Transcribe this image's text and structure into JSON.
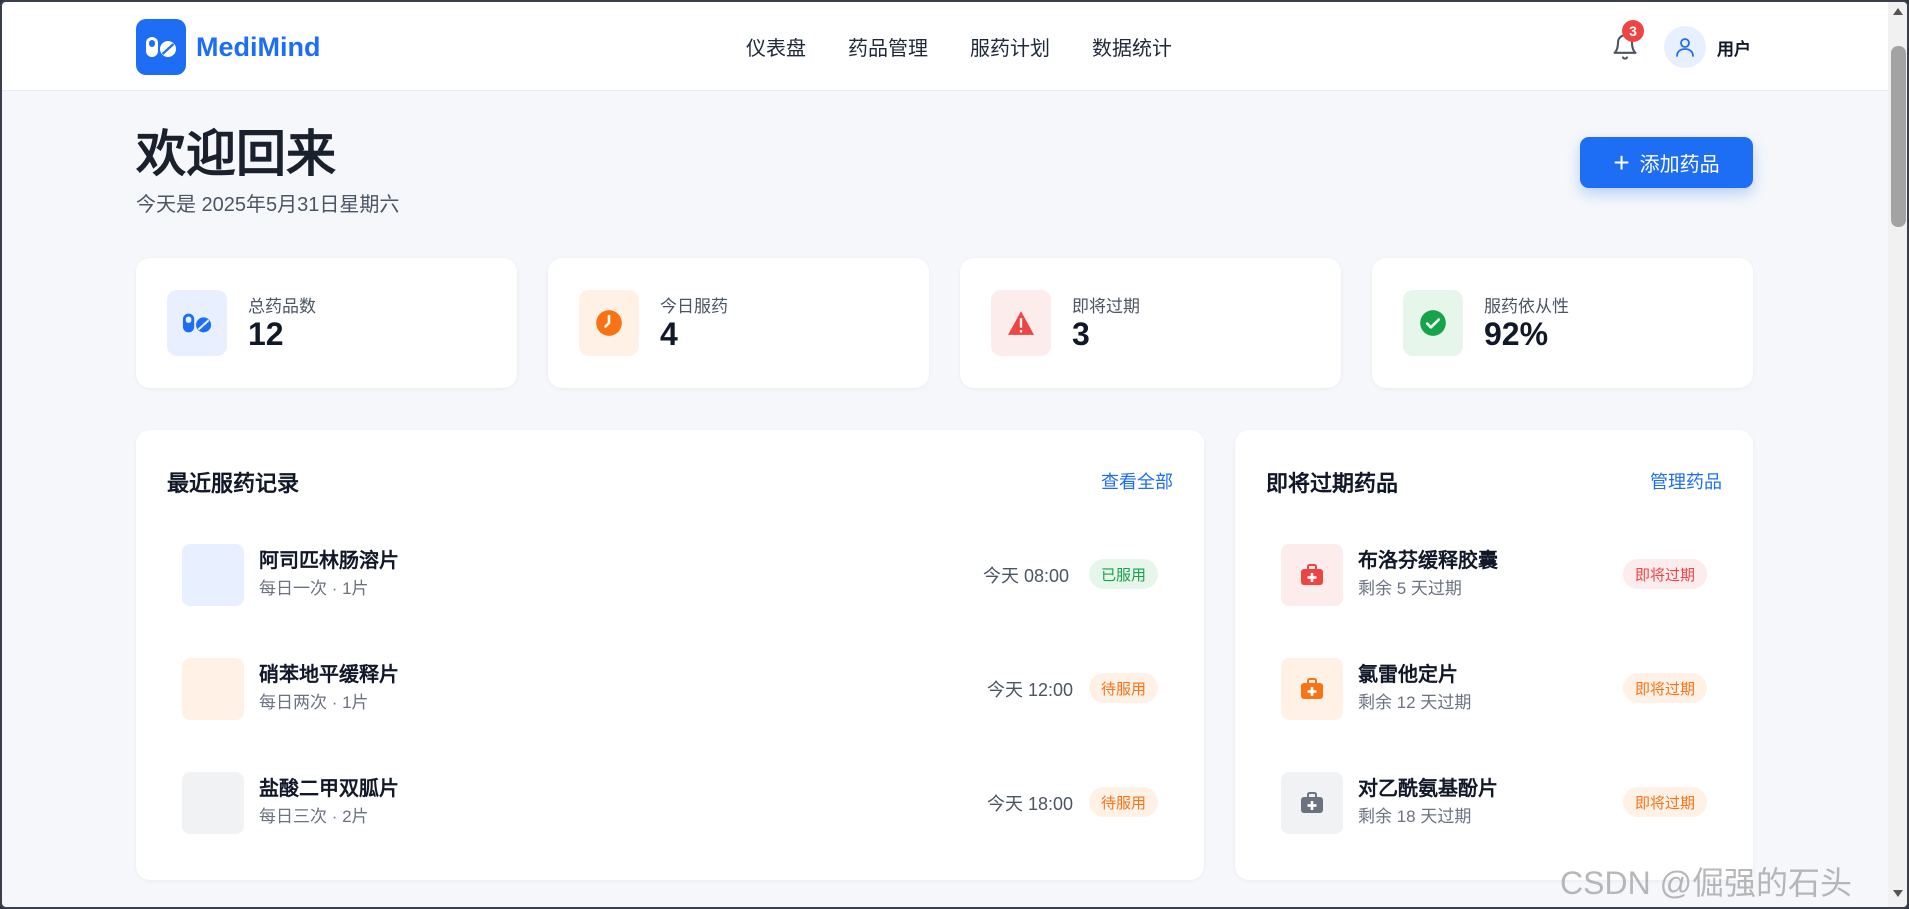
{
  "app": {
    "brand": "MediMind",
    "logo_icon": "pills-icon"
  },
  "nav": {
    "items": [
      "仪表盘",
      "药品管理",
      "服药计划",
      "数据统计"
    ]
  },
  "header": {
    "notification_count": "3",
    "user_label": "用户"
  },
  "welcome": {
    "title": "欢迎回来",
    "date": "今天是 2025年5月31日星期六",
    "add_button": "添加药品"
  },
  "stats": [
    {
      "label": "总药品数",
      "value": "12",
      "icon": "pills-icon",
      "color": "#1d6ef5",
      "bg": "#e8efff"
    },
    {
      "label": "今日服药",
      "value": "4",
      "icon": "clock-icon",
      "color": "#f97316",
      "bg": "#fff1e6"
    },
    {
      "label": "即将过期",
      "value": "3",
      "icon": "warning-icon",
      "color": "#ef4444",
      "bg": "#fdecec"
    },
    {
      "label": "服药依从性",
      "value": "92%",
      "icon": "check-circle-icon",
      "color": "#16a34a",
      "bg": "#e6f6ea"
    }
  ],
  "recent": {
    "title": "最近服药记录",
    "link": "查看全部",
    "items": [
      {
        "name": "阿司匹林肠溶片",
        "dose": "每日一次 · 1片",
        "time": "今天 08:00",
        "status": "已服用",
        "thumb_bg": "#e8efff",
        "badge_color": "#16a34a",
        "badge_bg": "#e6f6ea"
      },
      {
        "name": "硝苯地平缓释片",
        "dose": "每日两次 · 1片",
        "time": "今天 12:00",
        "status": "待服用",
        "thumb_bg": "#fff1e6",
        "badge_color": "#f97316",
        "badge_bg": "#fff1e6"
      },
      {
        "name": "盐酸二甲双胍片",
        "dose": "每日三次 · 2片",
        "time": "今天 18:00",
        "status": "待服用",
        "thumb_bg": "#f1f2f4",
        "badge_color": "#f97316",
        "badge_bg": "#fff1e6"
      }
    ]
  },
  "expiring": {
    "title": "即将过期药品",
    "link": "管理药品",
    "items": [
      {
        "name": "布洛芬缓释胶囊",
        "remain": "剩余 5 天过期",
        "status": "即将过期",
        "icon": "medkit-icon",
        "color": "#ef4444",
        "thumb_bg": "#fdecec",
        "badge_color": "#ef4444",
        "badge_bg": "#fdecec"
      },
      {
        "name": "氯雷他定片",
        "remain": "剩余 12 天过期",
        "status": "即将过期",
        "icon": "medkit-icon",
        "color": "#f97316",
        "thumb_bg": "#fff1e6",
        "badge_color": "#f97316",
        "badge_bg": "#fff1e6"
      },
      {
        "name": "对乙酰氨基酚片",
        "remain": "剩余 18 天过期",
        "status": "即将过期",
        "icon": "medkit-icon",
        "color": "#6b7280",
        "thumb_bg": "#f1f2f4",
        "badge_color": "#f97316",
        "badge_bg": "#fff1e6"
      }
    ]
  },
  "watermark": "CSDN @倔强的石头"
}
